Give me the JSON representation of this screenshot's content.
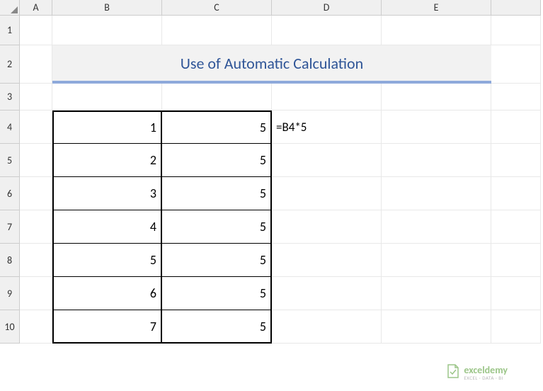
{
  "columns": [
    "A",
    "B",
    "C",
    "D",
    "E"
  ],
  "rows": [
    "1",
    "2",
    "3",
    "4",
    "5",
    "6",
    "7",
    "8",
    "9",
    "10"
  ],
  "title": "Use of Automatic Calculation",
  "formula": "=B4*5",
  "chart_data": {
    "type": "table",
    "columns": [
      "B",
      "C"
    ],
    "rows": [
      {
        "B": 1,
        "C": 5
      },
      {
        "B": 2,
        "C": 5
      },
      {
        "B": 3,
        "C": 5
      },
      {
        "B": 4,
        "C": 5
      },
      {
        "B": 5,
        "C": 5
      },
      {
        "B": 6,
        "C": 5
      },
      {
        "B": 7,
        "C": 5
      }
    ],
    "formula_shown": "=B4*5",
    "formula_location": "D4"
  },
  "watermark": {
    "name": "exceldemy",
    "tagline": "EXCEL · DATA · BI"
  }
}
